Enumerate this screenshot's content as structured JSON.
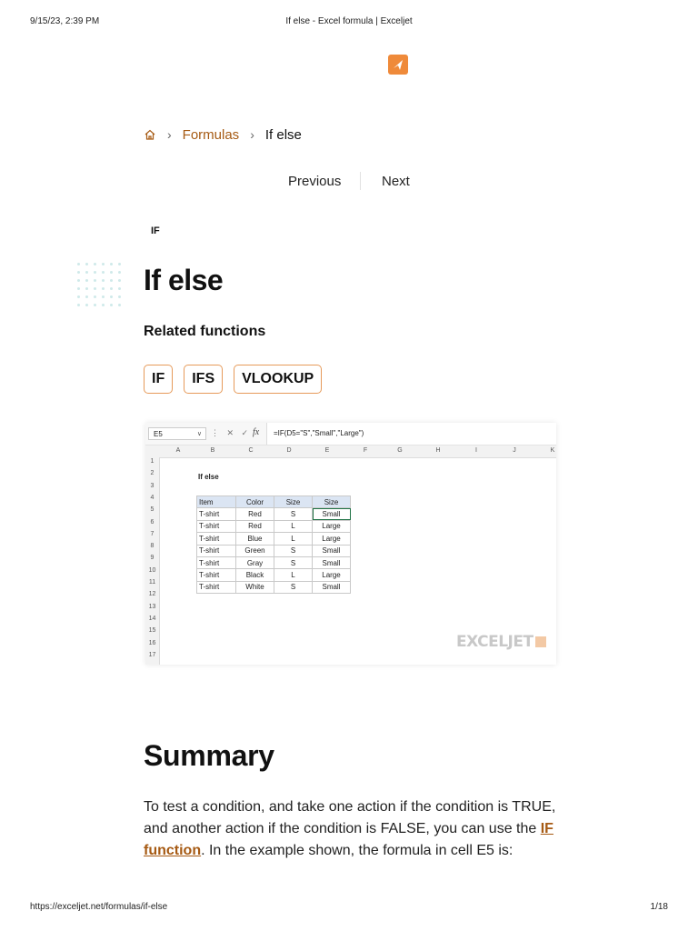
{
  "print_header": {
    "datetime": "9/15/23, 2:39 PM",
    "page_title": "If else - Excel formula | Exceljet"
  },
  "print_footer": {
    "url": "https://exceljet.net/formulas/if-else",
    "page": "1/18"
  },
  "breadcrumb": {
    "home_icon": "home-icon",
    "items": [
      "Formulas",
      "If else"
    ]
  },
  "pager": {
    "previous": "Previous",
    "next": "Next"
  },
  "category": "IF",
  "title": "If else",
  "related": {
    "heading": "Related functions",
    "functions": [
      "IF",
      "IFS",
      "VLOOKUP"
    ]
  },
  "sheet": {
    "name_box": "E5",
    "formula": "=IF(D5=\"S\",\"Small\",\"Large\")",
    "columns": [
      "A",
      "B",
      "C",
      "D",
      "E",
      "F",
      "G",
      "H",
      "I",
      "J",
      "K"
    ],
    "rows": [
      "1",
      "2",
      "3",
      "4",
      "5",
      "6",
      "7",
      "8",
      "9",
      "10",
      "11",
      "12",
      "13",
      "14",
      "15",
      "16",
      "17"
    ],
    "title": "If else",
    "headers": [
      "Item",
      "Color",
      "Size",
      "Size"
    ],
    "data": [
      [
        "T-shirt",
        "Red",
        "S",
        "Small"
      ],
      [
        "T-shirt",
        "Red",
        "L",
        "Large"
      ],
      [
        "T-shirt",
        "Blue",
        "L",
        "Large"
      ],
      [
        "T-shirt",
        "Green",
        "S",
        "Small"
      ],
      [
        "T-shirt",
        "Gray",
        "S",
        "Small"
      ],
      [
        "T-shirt",
        "Black",
        "L",
        "Large"
      ],
      [
        "T-shirt",
        "White",
        "S",
        "Small"
      ]
    ],
    "watermark": "EXCELJET"
  },
  "summary": {
    "heading": "Summary",
    "text_before": "To test a condition, and take one action if the condition is TRUE, and another action if the condition is FALSE, you can use the ",
    "link": "IF function",
    "text_after": ". In the example shown, the formula in cell E5 is:"
  },
  "colors": {
    "accent": "#a65a13",
    "brand": "#ef8a3a",
    "button_border": "#e69a5a"
  }
}
